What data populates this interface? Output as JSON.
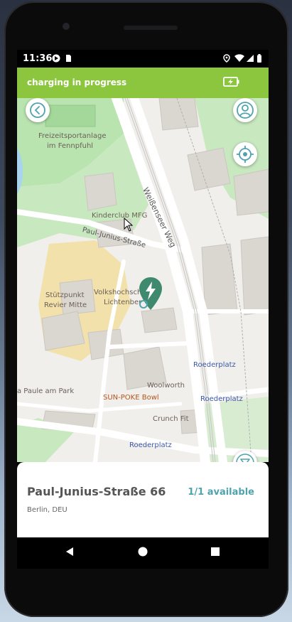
{
  "status_bar": {
    "time": "11:36",
    "icons": [
      "play-store-icon",
      "sim-card-icon",
      "location-icon",
      "wifi-icon",
      "signal-icon",
      "battery-icon"
    ]
  },
  "app_bar": {
    "title": "charging in progress",
    "action_icon": "charging-battery-icon",
    "color": "#8cc63f"
  },
  "map": {
    "labels": {
      "sports": "Freizeitsportanlage",
      "sports2": "im Fennpfuhl",
      "kinderclub": "Kinderclub MFG",
      "street1": "Paul-Junius-Straße",
      "street2": "Weißenseer Weg",
      "stuetz1": "Stützpunkt",
      "stuetz2": "Revier Mitte",
      "vhs1": "Volkshochsch",
      "vhs2": "Lichtenber",
      "roeder1": "Roederplatz",
      "roeder2": "Roederplatz",
      "roeder3": "Roederplatz",
      "woolworth": "Woolworth",
      "sunpoke": "SUN-POKE Bowl",
      "crunch": "Crunch Fit",
      "paule": "a Paule am Park"
    },
    "marker_icon": "charging-station-pin-icon"
  },
  "buttons": {
    "back_icon": "back-arrow-icon",
    "profile_icon": "user-profile-icon",
    "locate_icon": "my-location-icon",
    "filter_icon": "filter-icon"
  },
  "station": {
    "address": "Paul-Junius-Straße 66",
    "availability": "1/1 available",
    "city": "Berlin, DEU"
  },
  "nav_bar": {
    "icons": [
      "back-triangle-icon",
      "home-circle-icon",
      "recents-square-icon"
    ]
  },
  "colors": {
    "accent": "#8cc63f",
    "teal": "#4fa3ad",
    "marker": "#3f8a6e"
  }
}
